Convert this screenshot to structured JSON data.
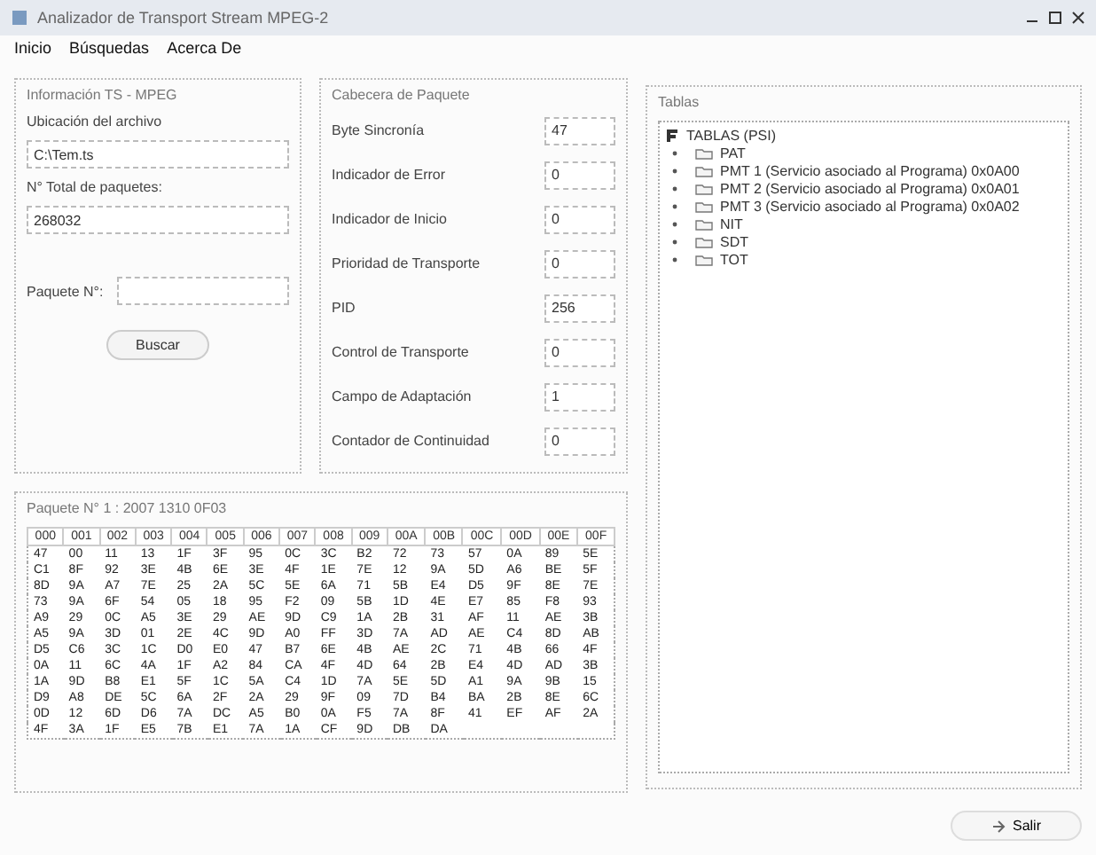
{
  "window": {
    "title": "Analizador de Transport Stream MPEG-2"
  },
  "menu": [
    {
      "label": "Inicio"
    },
    {
      "label": "Búsquedas"
    },
    {
      "label": "Acerca De"
    }
  ],
  "info": {
    "title": "Información TS - MPEG",
    "file_label": "Ubicación del archivo",
    "file_value": "C:\\Tem.ts",
    "total_label": "N° Total de paquetes:",
    "total_value": "268032",
    "packet_label": "Paquete N°:",
    "search_button": "Buscar"
  },
  "header": {
    "title": "Cabecera de Paquete",
    "fields": [
      {
        "label": "Byte Sincronía",
        "value": "47"
      },
      {
        "label": "Indicador de Error",
        "value": "0"
      },
      {
        "label": "Indicador de Inicio",
        "value": "0"
      },
      {
        "label": "Prioridad de Transporte",
        "value": "0"
      },
      {
        "label": "PID",
        "value": "256"
      },
      {
        "label": "Control de Transporte",
        "value": "0"
      },
      {
        "label": "Campo de Adaptación",
        "value": "1"
      },
      {
        "label": "Contador de Continuidad",
        "value": "0"
      }
    ]
  },
  "tables": {
    "title": "Tablas",
    "root": {
      "label": "TABLAS (PSI)",
      "children": [
        {
          "label": "PAT"
        },
        {
          "label": "PMT 1 (Servicio asociado al Programa) 0x0A00"
        },
        {
          "label": "PMT 2 (Servicio asociado al Programa) 0x0A01"
        },
        {
          "label": "PMT 3 (Servicio asociado al Programa) 0x0A02"
        },
        {
          "label": "NIT"
        },
        {
          "label": "SDT"
        },
        {
          "label": "TOT"
        }
      ]
    }
  },
  "hex": {
    "title": "Paquete N° 1 : 2007 1310 0F03",
    "columns": [
      "000",
      "001",
      "002",
      "003",
      "004",
      "005",
      "006",
      "007",
      "008",
      "009",
      "00A",
      "00B",
      "00C",
      "00D",
      "00E",
      "00F"
    ],
    "rows": [
      [
        "47",
        "00",
        "11",
        "13",
        "1F",
        "3F",
        "95",
        "0C",
        "3C",
        "B2",
        "72",
        "73",
        "57",
        "0A",
        "89",
        "5E"
      ],
      [
        "C1",
        "8F",
        "92",
        "3E",
        "4B",
        "6E",
        "3E",
        "4F",
        "1E",
        "7E",
        "12",
        "9A",
        "5D",
        "A6",
        "BE",
        "5F"
      ],
      [
        "8D",
        "9A",
        "A7",
        "7E",
        "25",
        "2A",
        "5C",
        "5E",
        "6A",
        "71",
        "5B",
        "E4",
        "D5",
        "9F",
        "8E",
        "7E"
      ],
      [
        "73",
        "9A",
        "6F",
        "54",
        "05",
        "18",
        "95",
        "F2",
        "09",
        "5B",
        "1D",
        "4E",
        "E7",
        "85",
        "F8",
        "93"
      ],
      [
        "A9",
        "29",
        "0C",
        "A5",
        "3E",
        "29",
        "AE",
        "9D",
        "C9",
        "1A",
        "2B",
        "31",
        "AF",
        "11",
        "AE",
        "3B"
      ],
      [
        "A5",
        "9A",
        "3D",
        "01",
        "2E",
        "4C",
        "9D",
        "A0",
        "FF",
        "3D",
        "7A",
        "AD",
        "AE",
        "C4",
        "8D",
        "AB"
      ],
      [
        "D5",
        "C6",
        "3C",
        "1C",
        "D0",
        "E0",
        "47",
        "B7",
        "6E",
        "4B",
        "AE",
        "2C",
        "71",
        "4B",
        "66",
        "4F"
      ],
      [
        "0A",
        "11",
        "6C",
        "4A",
        "1F",
        "A2",
        "84",
        "CA",
        "4F",
        "4D",
        "64",
        "2B",
        "E4",
        "4D",
        "AD",
        "3B"
      ],
      [
        "1A",
        "9D",
        "B8",
        "E1",
        "5F",
        "1C",
        "5A",
        "C4",
        "1D",
        "7A",
        "5E",
        "5D",
        "A1",
        "9A",
        "9B",
        "15"
      ],
      [
        "D9",
        "A8",
        "DE",
        "5C",
        "6A",
        "2F",
        "2A",
        "29",
        "9F",
        "09",
        "7D",
        "B4",
        "BA",
        "2B",
        "8E",
        "6C"
      ],
      [
        "0D",
        "12",
        "6D",
        "D6",
        "7A",
        "DC",
        "A5",
        "B0",
        "0A",
        "F5",
        "7A",
        "8F",
        "41",
        "EF",
        "AF",
        "2A"
      ],
      [
        "4F",
        "3A",
        "1F",
        "E5",
        "7B",
        "E1",
        "7A",
        "1A",
        "CF",
        "9D",
        "DB",
        "DA"
      ]
    ]
  },
  "exit_button": "Salir"
}
